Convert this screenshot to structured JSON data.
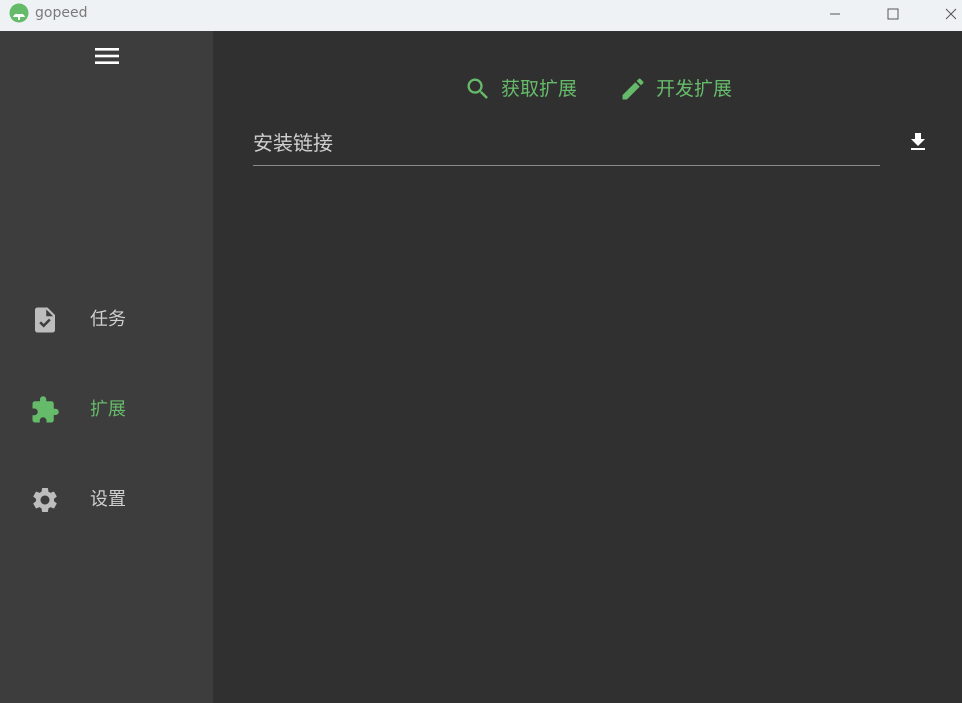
{
  "window": {
    "title": "gopeed",
    "controls": {
      "minimize_icon": "minimize-icon",
      "maximize_icon": "maximize-icon",
      "close_icon": "close-icon"
    }
  },
  "sidebar": {
    "menu_icon": "hamburger-menu-icon",
    "items": [
      {
        "label": "任务",
        "icon": "task-file-check-icon",
        "active": false
      },
      {
        "label": "扩展",
        "icon": "puzzle-extension-icon",
        "active": true
      },
      {
        "label": "设置",
        "icon": "gear-icon",
        "active": false
      }
    ]
  },
  "main": {
    "actions": [
      {
        "label": "获取扩展",
        "icon": "search-icon"
      },
      {
        "label": "开发扩展",
        "icon": "pencil-icon"
      }
    ],
    "install": {
      "placeholder": "安装链接",
      "value": "",
      "button_icon": "download-icon"
    }
  },
  "colors": {
    "accent": "#66bb6a",
    "sidebar_bg": "#3d3d3d",
    "main_bg": "#303030",
    "titlebar_bg": "#eff2f5"
  }
}
